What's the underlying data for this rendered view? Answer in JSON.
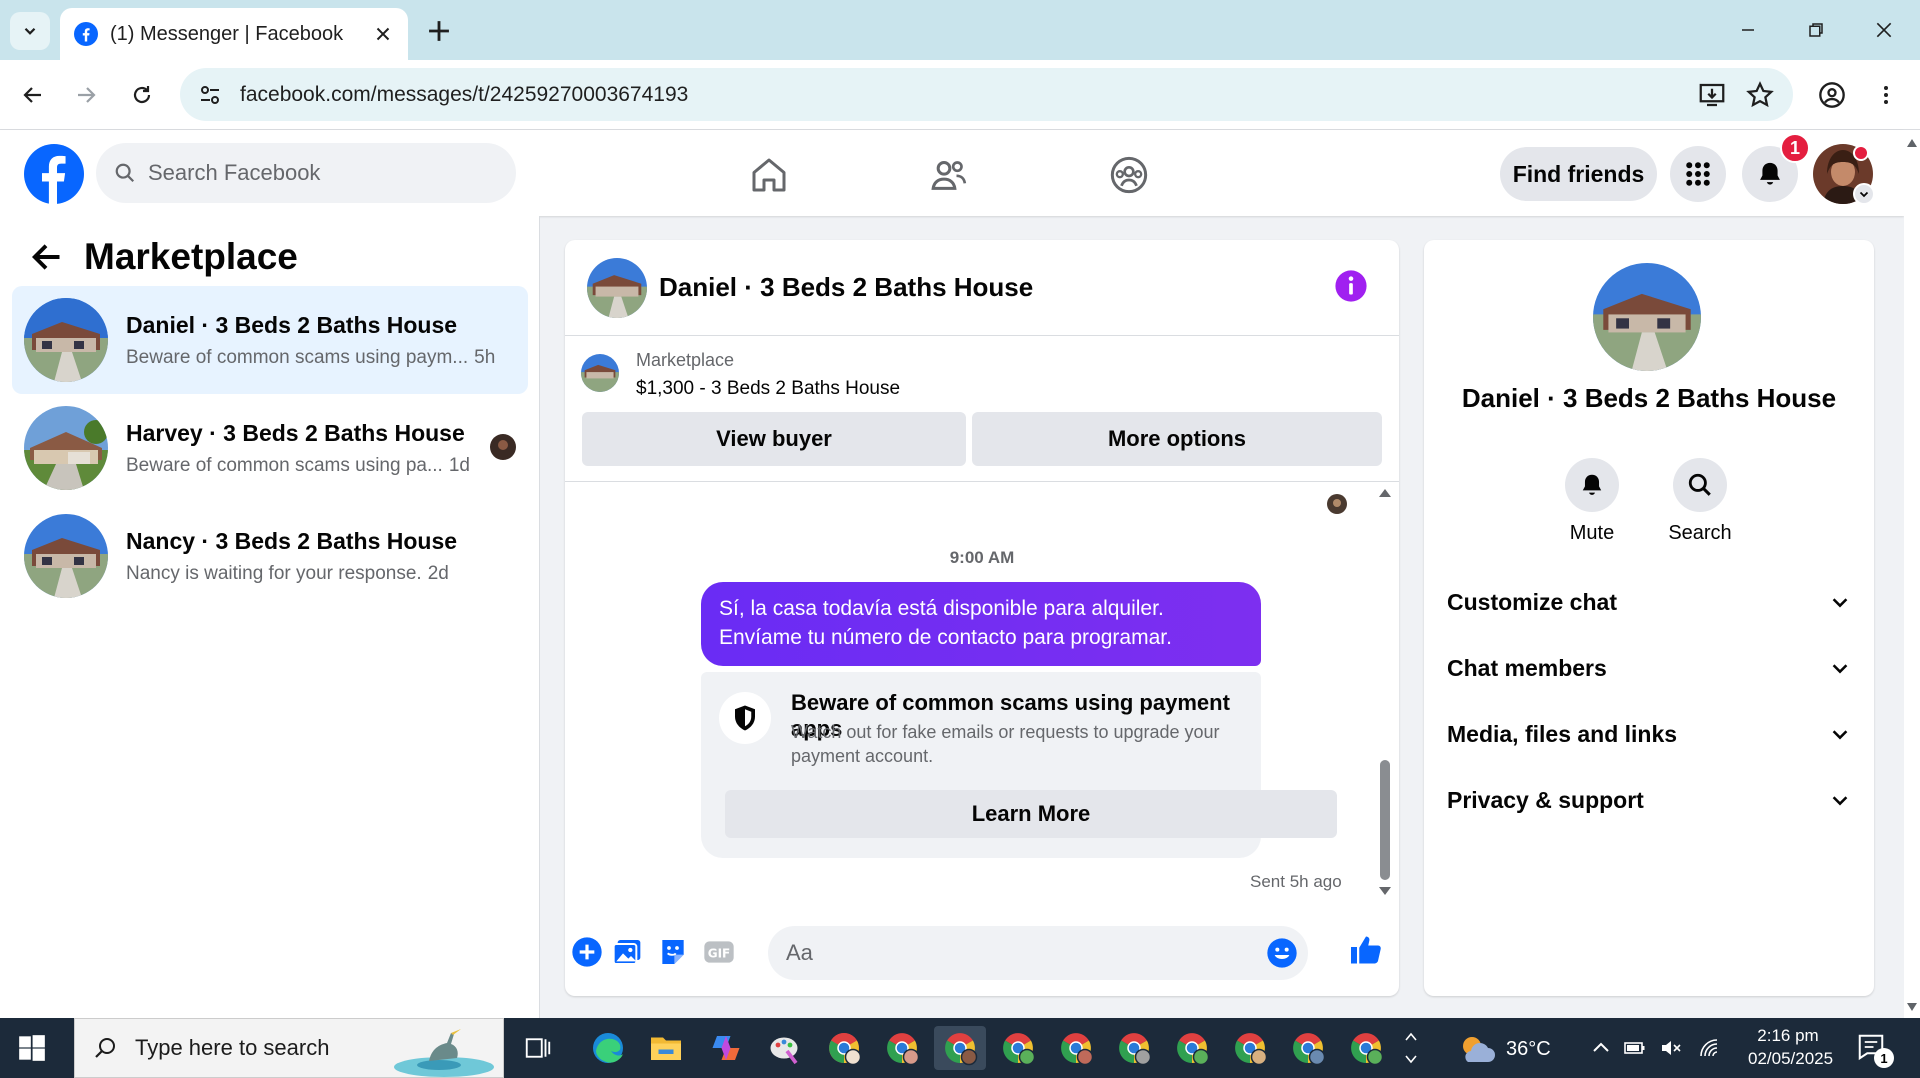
{
  "browser": {
    "tab_title": "(1) Messenger | Facebook",
    "url": "facebook.com/messages/t/24259270003674193"
  },
  "header": {
    "search_placeholder": "Search Facebook",
    "find_friends": "Find friends",
    "notification_count": "1"
  },
  "sidebar": {
    "title": "Marketplace",
    "conversations": [
      {
        "name": "Daniel · 3 Beds 2 Baths House",
        "preview": "Beware of common scams using paym...",
        "time": "5h"
      },
      {
        "name": "Harvey · 3 Beds 2 Baths House",
        "preview": "Beware of common scams using pa...",
        "time": "1d"
      },
      {
        "name": "Nancy · 3 Beds 2 Baths House",
        "preview": "Nancy is waiting for your response.",
        "time": "2d"
      }
    ]
  },
  "chat": {
    "title": "Daniel · 3 Beds 2 Baths House",
    "listing_label": "Marketplace",
    "listing_title": "$1,300 - 3 Beds 2 Baths House",
    "view_buyer": "View buyer",
    "more_options": "More options",
    "time_divider": "9:00 AM",
    "message": "Sí, la casa todavía está disponible para alquiler. Envíame tu número de contacto para programar.",
    "scam_title": "Beware of common scams using payment apps",
    "scam_desc": "Watch out for fake emails or requests to upgrade your payment account.",
    "learn_more": "Learn More",
    "sent_status": "Sent 5h ago",
    "composer_placeholder": "Aa"
  },
  "details": {
    "name": "Daniel · 3 Beds 2 Baths House",
    "mute": "Mute",
    "search": "Search",
    "sections": [
      "Customize chat",
      "Chat members",
      "Media, files and links",
      "Privacy & support"
    ]
  },
  "taskbar": {
    "search_placeholder": "Type here to search",
    "temperature": "36°C",
    "time": "2:16 pm",
    "date": "02/05/2025",
    "notif_count": "1"
  },
  "colors": {
    "fb_blue": "#0866ff",
    "messenger_purple": "#7b2ff7",
    "active_row": "#e7f3ff",
    "badge_red": "#e41e3f"
  }
}
